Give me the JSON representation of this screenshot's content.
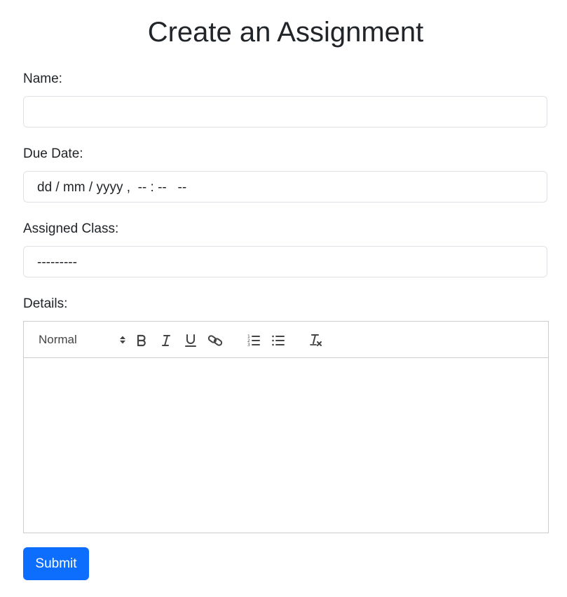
{
  "page": {
    "title": "Create an Assignment"
  },
  "form": {
    "name": {
      "label": "Name:",
      "value": ""
    },
    "due_date": {
      "label": "Due Date:",
      "placeholder": "dd / mm / yyyy ,  -- : --   --"
    },
    "assigned_class": {
      "label": "Assigned Class:",
      "selected": "---------"
    },
    "details": {
      "label": "Details:",
      "toolbar": {
        "header_picker": "Normal",
        "buttons": [
          {
            "name": "bold",
            "icon": "bold-icon"
          },
          {
            "name": "italic",
            "icon": "italic-icon"
          },
          {
            "name": "underline",
            "icon": "underline-icon"
          },
          {
            "name": "link",
            "icon": "link-icon"
          },
          {
            "name": "ordered-list",
            "icon": "ordered-list-icon"
          },
          {
            "name": "bullet-list",
            "icon": "bullet-list-icon"
          },
          {
            "name": "clean",
            "icon": "clear-formatting-icon"
          }
        ]
      },
      "content": ""
    },
    "submit_label": "Submit"
  },
  "colors": {
    "primary": "#0d6efd",
    "text": "#212529",
    "border": "#dee2e6",
    "editor_border": "#cccccc",
    "toolbar_icon": "#444444"
  }
}
